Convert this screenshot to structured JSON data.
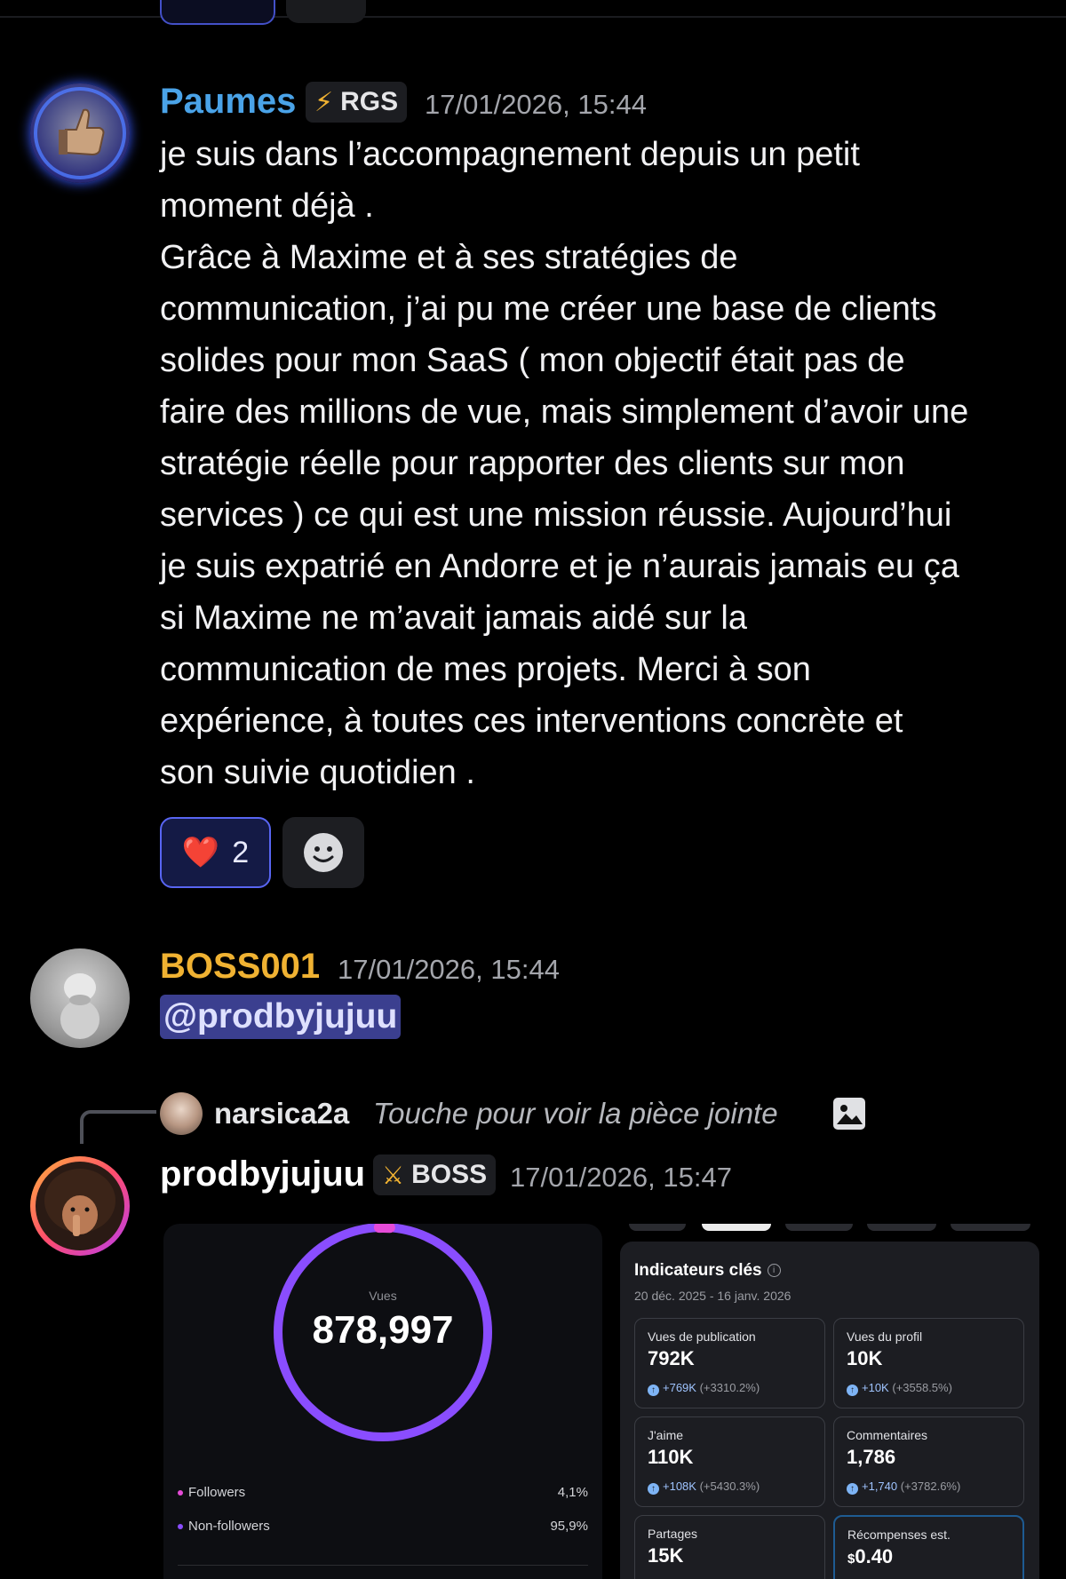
{
  "messages": [
    {
      "author": "Paumes",
      "author_color": "#4aa3e8",
      "badge": {
        "icon": "lightning-icon",
        "label": "RGS"
      },
      "timestamp": "17/01/2026, 15:44",
      "text": "je suis dans l’accompagnement depuis un petit\nmoment déjà .\nGrâce à Maxime et à ses stratégies de\ncommunication, j’ai pu me créer une base de clients\nsolides pour mon SaaS ( mon objectif était pas de\nfaire des millions de vue, mais simplement d’avoir une\nstratégie réelle pour rapporter des clients sur mon\nservices ) ce qui est une mission réussie. Aujourd’hui\nje suis expatrié en Andorre et je n’aurais jamais eu ça\nsi Maxime ne m’avait jamais aidé sur la\ncommunication de mes projets. Merci à son\nexpérience, à toutes ces interventions concrète et\nson suivie quotidien .",
      "reactions": [
        {
          "emoji": "❤️",
          "count": "2"
        }
      ]
    },
    {
      "author": "BOSS001",
      "author_color": "#f0b232",
      "timestamp": "17/01/2026, 15:44",
      "mention": "@prodbyjujuu"
    },
    {
      "reply_to": {
        "user": "narsica2a",
        "text": "Touche pour voir la pièce jointe"
      },
      "author": "prodbyjujuu",
      "author_color": "#ffffff",
      "badge": {
        "icon": "sword-icon",
        "label": "BOSS"
      },
      "timestamp": "17/01/2026, 15:47"
    }
  ],
  "attachments": {
    "views_card": {
      "label": "Vues",
      "value": "878,997",
      "followers_share": 0.041,
      "legend": [
        {
          "label": "Followers",
          "pct": "4,1%",
          "color": "#e64bd8"
        },
        {
          "label": "Non-followers",
          "pct": "95,9%",
          "color": "#8a4dff"
        }
      ]
    },
    "indicators": {
      "title": "Indicateurs clés",
      "date_range": "20 déc. 2025 - 16 janv. 2026",
      "metrics": [
        {
          "label": "Vues de publication",
          "value": "792K",
          "delta": "+769K",
          "pct": "(+3310.2%)"
        },
        {
          "label": "Vues du profil",
          "value": "10K",
          "delta": "+10K",
          "pct": "(+3558.5%)"
        },
        {
          "label": "J'aime",
          "value": "110K",
          "delta": "+108K",
          "pct": "(+5430.3%)"
        },
        {
          "label": "Commentaires",
          "value": "1,786",
          "delta": "+1,740",
          "pct": "(+3782.6%)"
        },
        {
          "label": "Partages",
          "value": "15K"
        },
        {
          "label": "Récompenses est.",
          "currency": "$",
          "value": "0.40"
        }
      ]
    }
  }
}
